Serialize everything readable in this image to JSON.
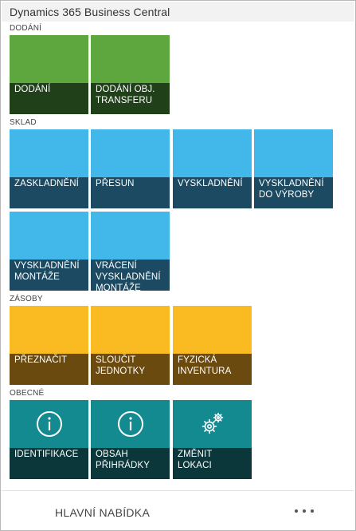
{
  "app": {
    "title": "Dynamics 365 Business Central"
  },
  "sections": {
    "dodani": {
      "label": "DODÁNÍ",
      "tiles": [
        {
          "label": "DODÁNÍ",
          "color": "#5ea63e"
        },
        {
          "label": "DODÁNÍ OBJ. TRANSFERU",
          "color": "#5ea63e"
        }
      ]
    },
    "sklad": {
      "label": "SKLAD",
      "tiles": [
        {
          "label": "ZASKLADNĚNÍ",
          "color": "#42b7ea"
        },
        {
          "label": "PŘESUN",
          "color": "#42b7ea"
        },
        {
          "label": "VYSKLADNĚNÍ",
          "color": "#42b7ea"
        },
        {
          "label": "VYSKLADNĚNÍ DO VÝROBY",
          "color": "#42b7ea"
        },
        {
          "label": "VYSKLADNĚNÍ MONTÁŽE",
          "color": "#42b7ea"
        },
        {
          "label": "VRÁCENÍ VYSKLADNĚNÍ MONTÁŽE",
          "color": "#42b7ea"
        }
      ]
    },
    "zasoby": {
      "label": "ZÁSOBY",
      "tiles": [
        {
          "label": "PŘEZNAČIT",
          "color": "#f9bb21"
        },
        {
          "label": "SLOUČIT JEDNOTKY",
          "color": "#f9bb21"
        },
        {
          "label": "FYZICKÁ INVENTURA",
          "color": "#f9bb21"
        }
      ]
    },
    "obecne": {
      "label": "OBECNÉ",
      "tiles": [
        {
          "label": "IDENTIFIKACE",
          "icon": "info-icon",
          "color": "#138990"
        },
        {
          "label": "OBSAH PŘIHRÁDKY",
          "icon": "info-icon",
          "color": "#138990"
        },
        {
          "label": "ZMĚNIT LOKACI",
          "icon": "gears-icon",
          "color": "#138990"
        }
      ]
    }
  },
  "footer": {
    "main_menu_label": "HLAVNÍ NABÍDKA",
    "more_icon": "more-icon"
  }
}
